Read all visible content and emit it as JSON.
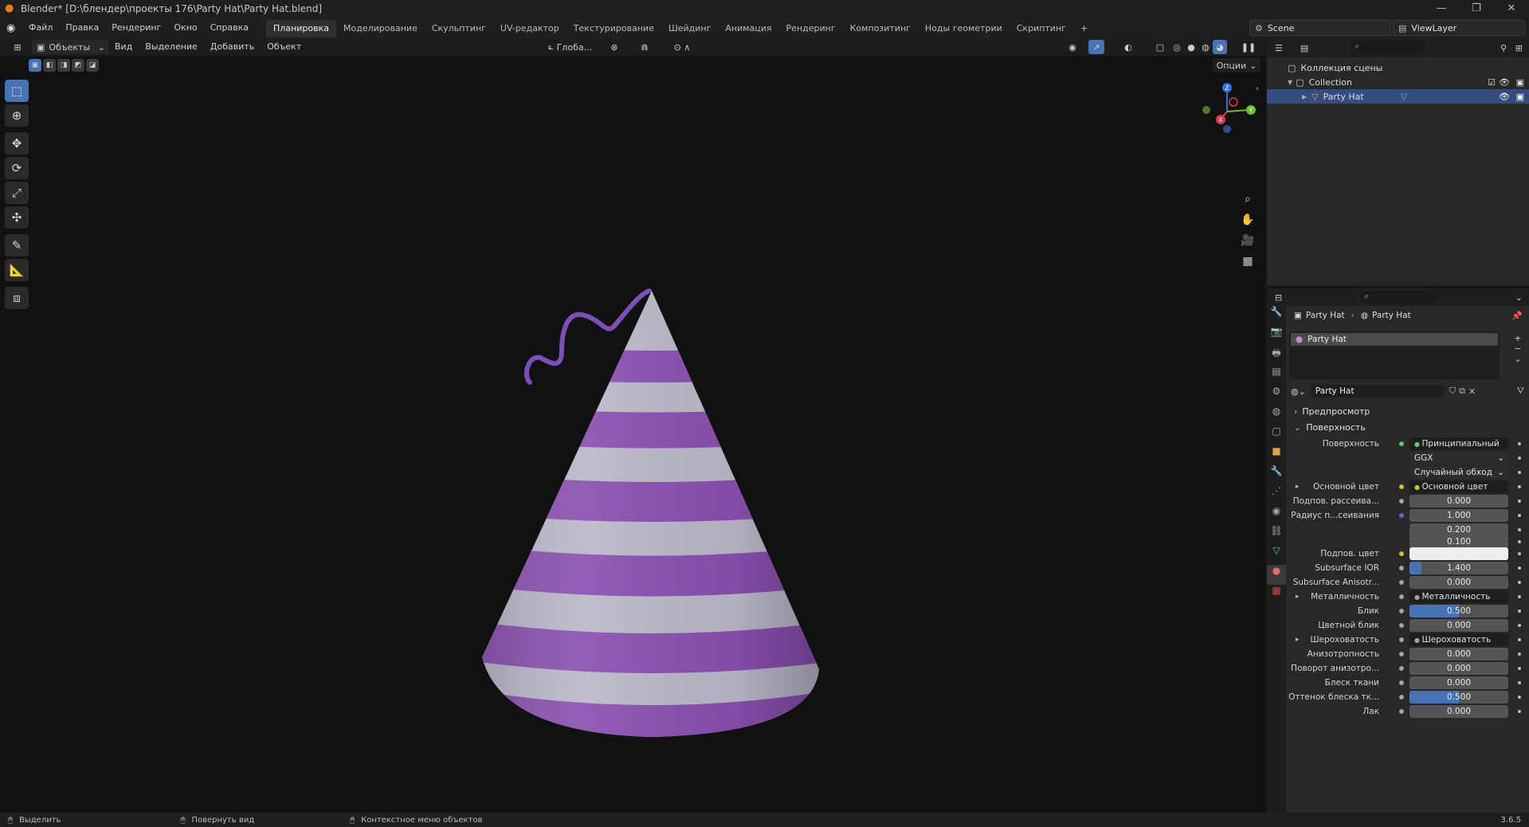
{
  "window": {
    "title": "Blender* [D:\\блендер\\проекты 176\\Party Hat\\Party Hat.blend]",
    "controls": [
      "—",
      "❐",
      "✕"
    ]
  },
  "menu": {
    "items": [
      "Файл",
      "Правка",
      "Рендеринг",
      "Окно",
      "Справка"
    ],
    "workspaces": [
      "Планировка",
      "Моделирование",
      "Скульптинг",
      "UV-редактор",
      "Текстурирование",
      "Шейдинг",
      "Анимация",
      "Рендеринг",
      "Композитинг",
      "Ноды геометрии",
      "Скриптинг"
    ],
    "add_workspace": "+",
    "scene": "Scene",
    "view_layer": "ViewLayer"
  },
  "viewport_header": {
    "mode": "Объекты",
    "menus": [
      "Вид",
      "Выделение",
      "Добавить",
      "Объект"
    ],
    "transform_orientation": "Глоба...",
    "options": "Опции"
  },
  "gizmo": {
    "x": "X",
    "y": "Y",
    "z": "Z"
  },
  "tools": [
    "select-box",
    "cursor",
    "move",
    "rotate",
    "scale",
    "transform",
    "annotate",
    "measure",
    "add-cube"
  ],
  "outliner": {
    "root": "Коллекция сцены",
    "collection": "Collection",
    "object": "Party Hat"
  },
  "properties": {
    "breadcrumb": [
      "Party Hat",
      "Party Hat"
    ],
    "material_slot": "Party Hat",
    "material_name": "Party Hat",
    "panels": {
      "preview": "Предпросмотр",
      "surface": "Поверхность"
    },
    "rows": [
      {
        "label": "Поверхность",
        "kind": "node",
        "value": "Принципиальный BSDF",
        "dot": "#63c763"
      },
      {
        "label": "",
        "kind": "enum",
        "value": "GGX"
      },
      {
        "label": "",
        "kind": "enum",
        "value": "Случайный обход"
      },
      {
        "label": "Основной цвет",
        "kind": "node",
        "value": "Основной цвет",
        "dot": "#c7c729",
        "expand": true
      },
      {
        "label": "Подпов. рассеива...",
        "kind": "num",
        "value": "0.000",
        "dot": "#a1a1a1",
        "fill": 0
      },
      {
        "label": "Радиус п...сеивания",
        "kind": "num",
        "value": "1.000",
        "dot": "#6363c7",
        "fill": 0
      },
      {
        "label": "",
        "kind": "num",
        "value": "0.200",
        "fill": 0
      },
      {
        "label": "",
        "kind": "num",
        "value": "0.100",
        "fill": 0
      },
      {
        "label": "Подпов. цвет",
        "kind": "color",
        "value": "",
        "dot": "#c7c729",
        "color": "#eeeeee"
      },
      {
        "label": "Subsurface IOR",
        "kind": "num",
        "value": "1.400",
        "dot": "#a1a1a1",
        "fill": 0.12
      },
      {
        "label": "Subsurface Anisotr...",
        "kind": "num",
        "value": "0.000",
        "dot": "#a1a1a1",
        "fill": 0
      },
      {
        "label": "Металличность",
        "kind": "node",
        "value": "Металличность",
        "dot": "#a1a1a1",
        "expand": true
      },
      {
        "label": "Блик",
        "kind": "num",
        "value": "0.500",
        "dot": "#a1a1a1",
        "fill": 0.5
      },
      {
        "label": "Цветной блик",
        "kind": "num",
        "value": "0.000",
        "dot": "#a1a1a1",
        "fill": 0
      },
      {
        "label": "Шероховатость",
        "kind": "node",
        "value": "Шероховатость",
        "dot": "#a1a1a1",
        "expand": true
      },
      {
        "label": "Анизотропность",
        "kind": "num",
        "value": "0.000",
        "dot": "#a1a1a1",
        "fill": 0
      },
      {
        "label": "Поворот анизотро...",
        "kind": "num",
        "value": "0.000",
        "dot": "#a1a1a1",
        "fill": 0
      },
      {
        "label": "Блеск ткани",
        "kind": "num",
        "value": "0.000",
        "dot": "#a1a1a1",
        "fill": 0
      },
      {
        "label": "Оттенок блеска тк...",
        "kind": "num",
        "value": "0.500",
        "dot": "#a1a1a1",
        "fill": 0.5
      },
      {
        "label": "Лак",
        "kind": "num",
        "value": "0.000",
        "dot": "#a1a1a1",
        "fill": 0
      }
    ]
  },
  "statusbar": {
    "select": "Выделить",
    "rotate_view": "Повернуть вид",
    "context_menu": "Контекстное меню объектов",
    "version": "3.6.5"
  },
  "colors": {
    "accent": "#4772b3",
    "hat_purple": "#8a4fb0",
    "hat_white": "#b9b8c8",
    "ribbon": "#7a4fb8"
  }
}
